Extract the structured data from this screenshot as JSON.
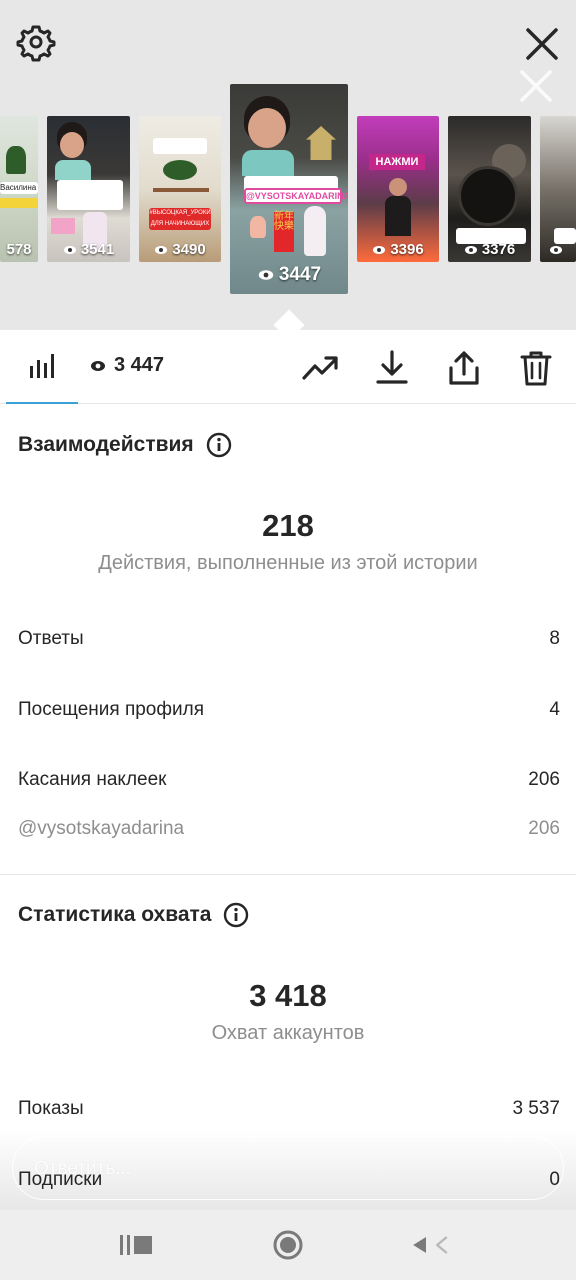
{
  "top": {
    "icons": {
      "settings": "gear-icon",
      "close": "close-icon"
    },
    "stories": [
      {
        "views": "578",
        "text": [
          "Василина"
        ]
      },
      {
        "views": "3541",
        "text": []
      },
      {
        "views": "3490",
        "text": [
          "#ВЫСОЦКАЯ_УРОКИ",
          "ДЛЯ НАЧИНАЮЩИХ"
        ]
      },
      {
        "views": "3447",
        "text": [
          "@VYSOTSKAYADARINA",
          "新年快樂"
        ],
        "active": true
      },
      {
        "views": "3396",
        "text": [
          "НАЖМИ"
        ]
      },
      {
        "views": "3376",
        "text": []
      },
      {
        "views": "",
        "text": []
      }
    ]
  },
  "toolbar": {
    "views": "3 447",
    "icons": [
      "insights-bars-icon",
      "eye-icon",
      "trending-icon",
      "download-icon",
      "share-icon",
      "trash-icon"
    ]
  },
  "interactions": {
    "title": "Взаимодействия",
    "total": "218",
    "caption": "Действия, выполненные из этой истории",
    "rows": [
      {
        "label": "Ответы",
        "value": "8"
      },
      {
        "label": "Посещения профиля",
        "value": "4"
      },
      {
        "label": "Касания наклеек",
        "value": "206"
      }
    ],
    "sub_row": {
      "label": "@vysotskayadarina",
      "value": "206"
    }
  },
  "reach": {
    "title": "Статистика охвата",
    "total": "3 418",
    "caption": "Охват аккаунтов",
    "rows": [
      {
        "label": "Показы",
        "value": "3 537"
      },
      {
        "label": "Подписки",
        "value": "0"
      }
    ]
  },
  "reply": {
    "placeholder": "Ответить..."
  },
  "colors": {
    "accent": "#3aa0d8",
    "text": "#262626",
    "muted": "#8e8e8e"
  }
}
